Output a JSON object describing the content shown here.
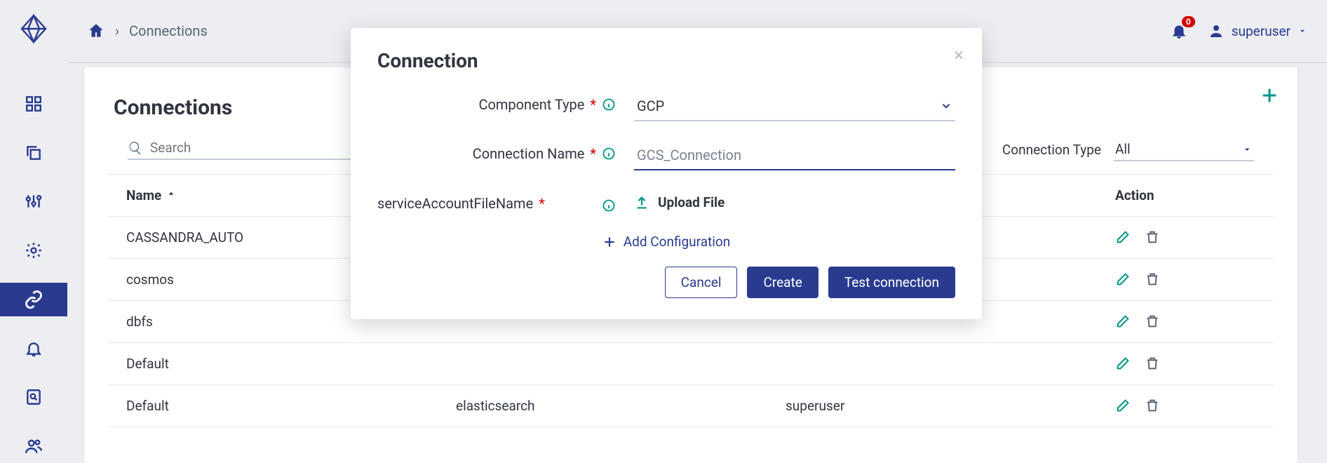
{
  "header": {
    "breadcrumb": "Connections",
    "notif_count": "0",
    "username": "superuser"
  },
  "page": {
    "title": "Connections",
    "search_placeholder": "Search",
    "filter_label": "Connection Type",
    "filter_value": "All",
    "col_name": "Name",
    "col_action": "Action",
    "col_type_hidden": "elasticsearch",
    "col_owner_hidden": "superuser"
  },
  "rows": [
    {
      "name": "CASSANDRA_AUTO",
      "type": "",
      "owner": ""
    },
    {
      "name": "cosmos",
      "type": "",
      "owner": ""
    },
    {
      "name": "dbfs",
      "type": "",
      "owner": ""
    },
    {
      "name": "Default",
      "type": "",
      "owner": ""
    },
    {
      "name": "Default",
      "type": "elasticsearch",
      "owner": "superuser"
    }
  ],
  "modal": {
    "title": "Connection",
    "label_component_type": "Component Type",
    "value_component_type": "GCP",
    "label_connection_name": "Connection Name",
    "value_connection_name": "GCS_Connection",
    "label_svc_file": "serviceAccountFileName",
    "upload_label": "Upload File",
    "add_config": "Add Configuration",
    "btn_cancel": "Cancel",
    "btn_create": "Create",
    "btn_test": "Test connection"
  }
}
